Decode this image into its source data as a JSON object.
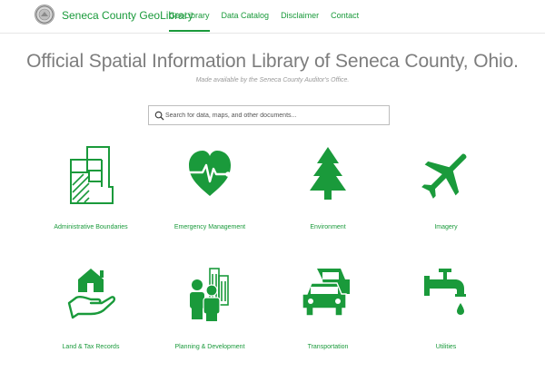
{
  "header": {
    "brand": "Seneca County GeoLibrary",
    "nav": [
      "GeoLibrary",
      "Data Catalog",
      "Disclaimer",
      "Contact"
    ],
    "active_nav": "GeoLibrary"
  },
  "hero": {
    "title": "Official Spatial Information Library of Seneca County, Ohio.",
    "subtitle": "Made available by the Seneca County Auditor's Office."
  },
  "search": {
    "placeholder": "Search for data, maps, and other documents..."
  },
  "categories": [
    {
      "label": "Administrative Boundaries",
      "icon": "boundaries-map-icon"
    },
    {
      "label": "Emergency Management",
      "icon": "heart-pulse-icon"
    },
    {
      "label": "Environment",
      "icon": "tree-icon"
    },
    {
      "label": "Imagery",
      "icon": "airplane-icon"
    },
    {
      "label": "Land & Tax Records",
      "icon": "house-in-hand-icon"
    },
    {
      "label": "Planning & Development",
      "icon": "people-buildings-icon"
    },
    {
      "label": "Transportation",
      "icon": "cars-icon"
    },
    {
      "label": "Utilities",
      "icon": "water-faucet-icon"
    }
  ],
  "colors": {
    "accent": "#1a9a3b",
    "title": "#7d7d7d",
    "subtitle": "#9a9a9a"
  }
}
